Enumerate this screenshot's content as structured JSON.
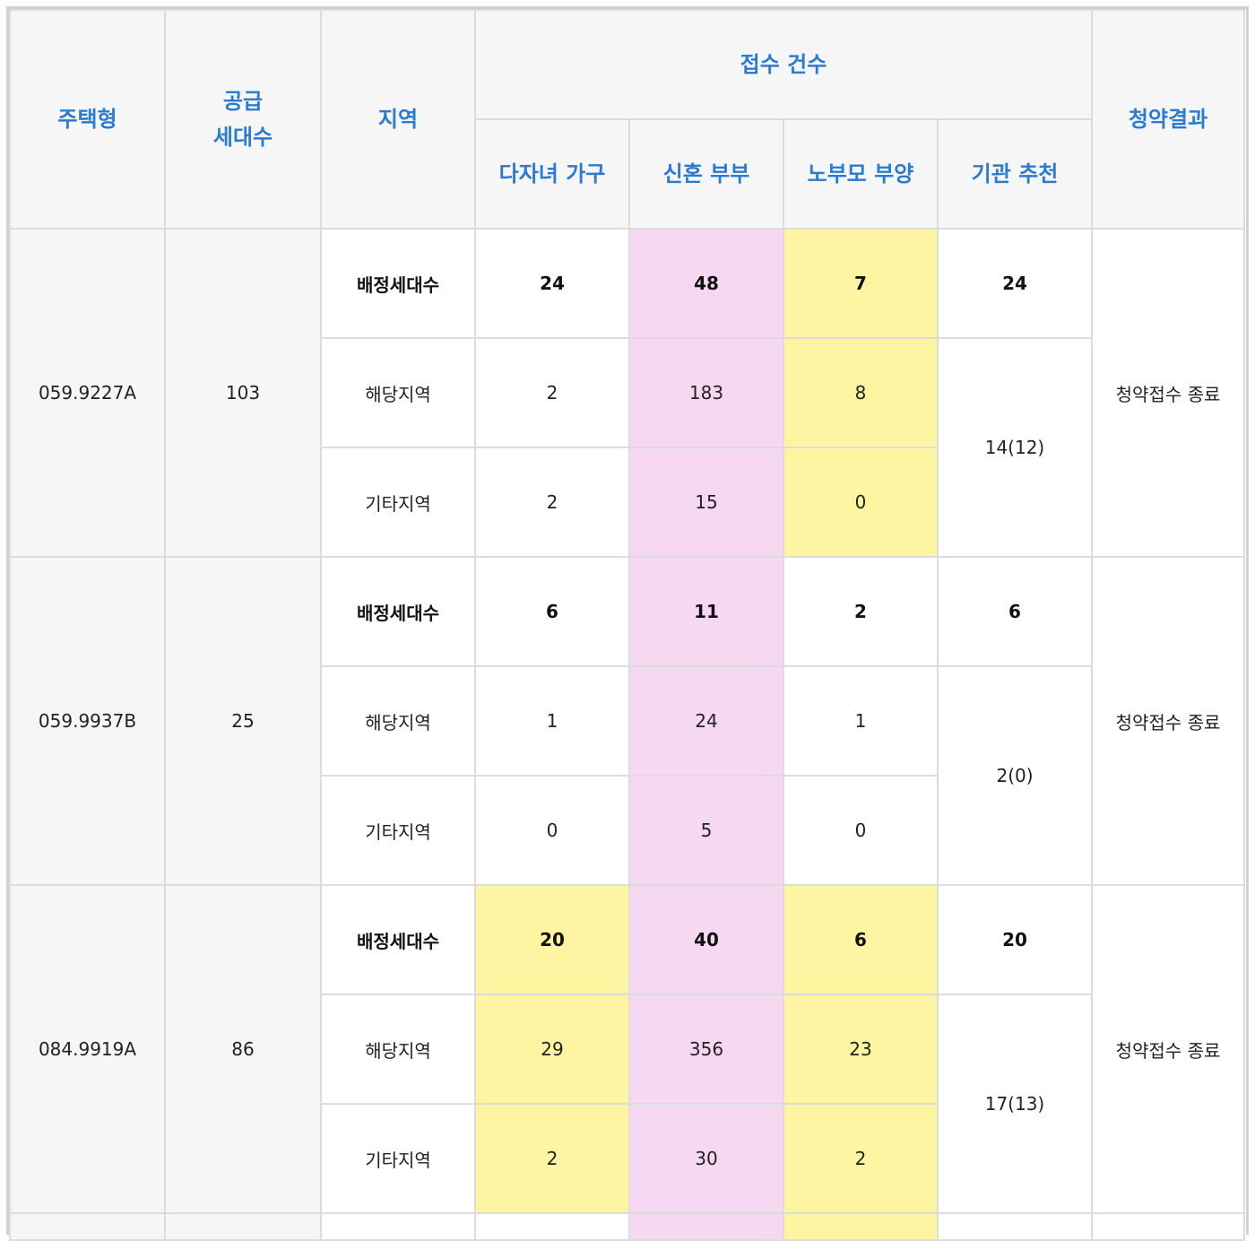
{
  "table": {
    "headers": {
      "housing_type": "주택형",
      "supply_line1": "공급",
      "supply_line2": "세대수",
      "region": "지역",
      "applications": "접수 건수",
      "multi_child": "다자녀 가구",
      "newlywed": "신혼 부부",
      "elderly_parent": "노부모 부양",
      "institution": "기관 추천",
      "result": "청약결과"
    },
    "row_labels": {
      "allocated": "배정세대수",
      "local": "해당지역",
      "other": "기타지역"
    },
    "groups": [
      {
        "housing_type": "059.9227A",
        "supply": "103",
        "allocated": {
          "multi_child": "24",
          "newlywed": "48",
          "elderly_parent": "7",
          "institution": "24"
        },
        "local": {
          "multi_child": "2",
          "newlywed": "183",
          "elderly_parent": "8"
        },
        "other": {
          "multi_child": "2",
          "newlywed": "15",
          "elderly_parent": "0"
        },
        "institution_received": "14(12)",
        "result": "청약접수 종료",
        "highlight": {
          "multi_child": "none",
          "newlywed": "#f6d8f3",
          "elderly_parent": "#fef5a2"
        }
      },
      {
        "housing_type": "059.9937B",
        "supply": "25",
        "allocated": {
          "multi_child": "6",
          "newlywed": "11",
          "elderly_parent": "2",
          "institution": "6"
        },
        "local": {
          "multi_child": "1",
          "newlywed": "24",
          "elderly_parent": "1"
        },
        "other": {
          "multi_child": "0",
          "newlywed": "5",
          "elderly_parent": "0"
        },
        "institution_received": "2(0)",
        "result": "청약접수 종료",
        "highlight": {
          "multi_child": "none",
          "newlywed": "#f6d8f3",
          "elderly_parent": "none"
        }
      },
      {
        "housing_type": "084.9919A",
        "supply": "86",
        "allocated": {
          "multi_child": "20",
          "newlywed": "40",
          "elderly_parent": "6",
          "institution": "20"
        },
        "local": {
          "multi_child": "29",
          "newlywed": "356",
          "elderly_parent": "23"
        },
        "other": {
          "multi_child": "2",
          "newlywed": "30",
          "elderly_parent": "2"
        },
        "institution_received": "17(13)",
        "result": "청약접수 종료",
        "highlight": {
          "multi_child": "#fef5a2",
          "newlywed": "#f6d8f3",
          "elderly_parent": "#fef5a2"
        }
      }
    ]
  }
}
